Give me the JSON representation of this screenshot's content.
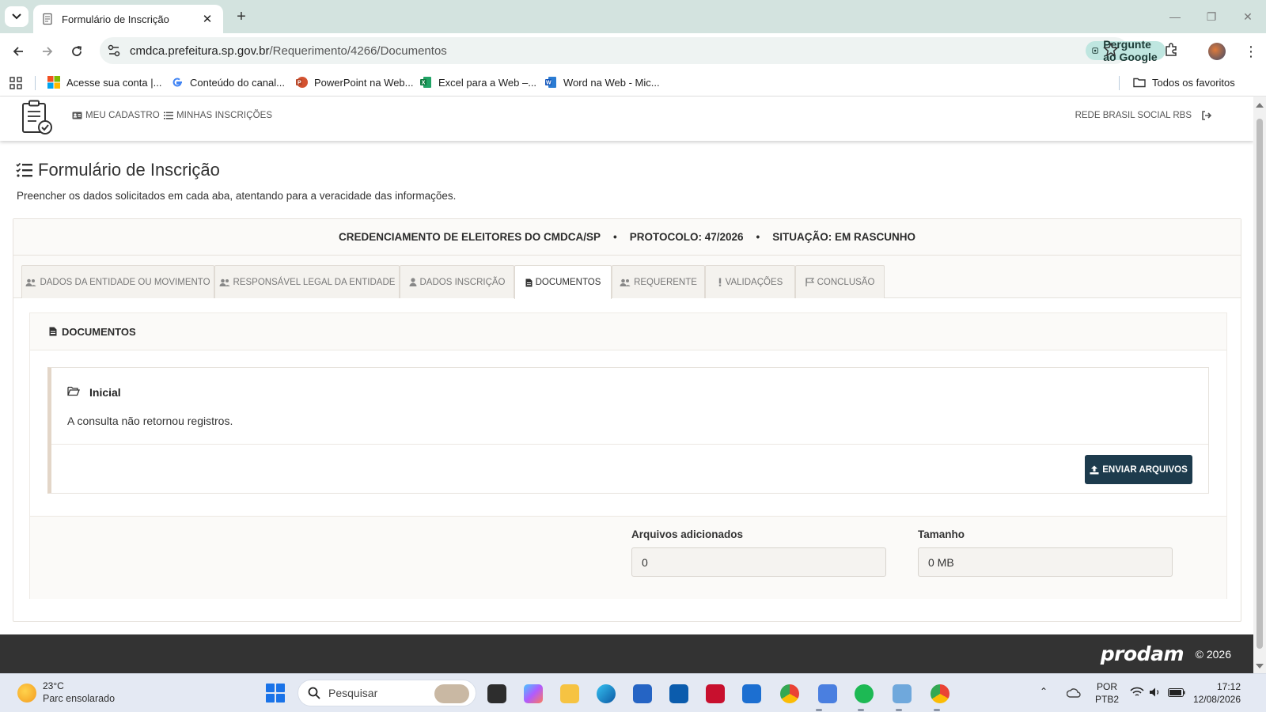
{
  "browser": {
    "tab_title": "Formulário de Inscrição",
    "url_domain": "cmdca.prefeitura.sp.gov.br",
    "url_path": "/Requerimento/4266/Documentos",
    "ask_google": "Pergunte ao Google",
    "bookmarks": [
      "Acesse sua conta |...",
      "Conteúdo do canal...",
      "PowerPoint na Web...",
      "Excel para a Web –...",
      "Word na Web - Mic..."
    ],
    "all_bookmarks": "Todos os favoritos"
  },
  "app": {
    "nav": {
      "my_registration": "MEU CADASTRO",
      "my_inscriptions": "MINHAS INSCRIÇÕES",
      "user": "REDE BRASIL SOCIAL RBS"
    },
    "title": "Formulário de Inscrição",
    "subtitle": "Preencher os dados solicitados em cada aba, atentando para a veracidade das informações.",
    "header": {
      "process": "CREDENCIAMENTO DE ELEITORES DO CMDCA/SP",
      "protocol": "PROTOCOLO: 47/2026",
      "status": "SITUAÇÃO: EM RASCUNHO",
      "separator": "•"
    },
    "tabs": [
      {
        "label": "DADOS DA ENTIDADE OU MOVIMENTO",
        "icon": "users-icon"
      },
      {
        "label": "RESPONSÁVEL LEGAL DA ENTIDADE",
        "icon": "users-icon"
      },
      {
        "label": "DADOS INSCRIÇÃO",
        "icon": "user-icon"
      },
      {
        "label": "DOCUMENTOS",
        "icon": "file-icon",
        "active": true
      },
      {
        "label": "REQUERENTE",
        "icon": "users-icon"
      },
      {
        "label": "VALIDAÇÕES",
        "icon": "exclamation-icon"
      },
      {
        "label": "CONCLUSÃO",
        "icon": "flag-icon"
      }
    ],
    "documents": {
      "section_title": "DOCUMENTOS",
      "category": "Inicial",
      "empty_message": "A consulta não retornou registros.",
      "upload_button": "ENVIAR ARQUIVOS",
      "files_added_label": "Arquivos adicionados",
      "files_added_value": "0",
      "size_label": "Tamanho",
      "size_value": "0 MB"
    },
    "footer": {
      "brand": "prodam",
      "copyright": "© 2026"
    }
  },
  "taskbar": {
    "temperature": "23°C",
    "condition": "Parc ensolarado",
    "search_placeholder": "Pesquisar",
    "lang": "POR",
    "layout": "PTB2",
    "time": "17:12",
    "date": "12/08/2026"
  },
  "colors": {
    "primary_button": "#1d3b4d",
    "footer": "#333333",
    "ask_google_bg": "#bfe6e0"
  }
}
